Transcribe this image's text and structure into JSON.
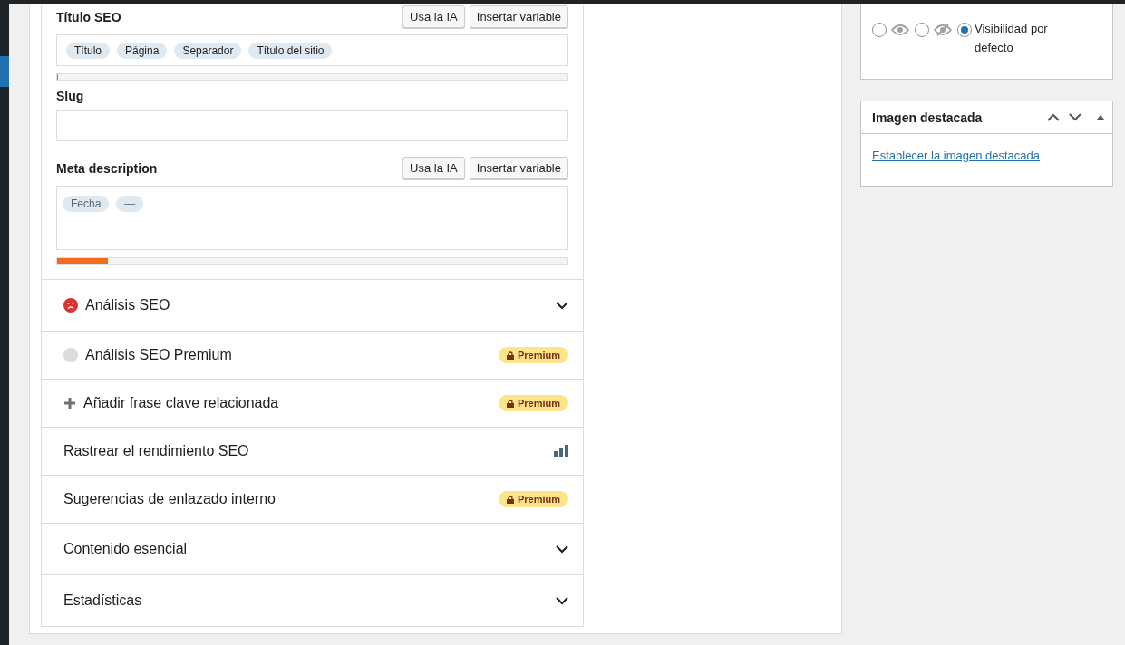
{
  "seo_title": {
    "label": "Título SEO",
    "buttons": [
      "Usa la IA",
      "Insertar variable"
    ],
    "tags": [
      "Título",
      "Página",
      "Separador",
      "Título del sitio"
    ],
    "level": 0
  },
  "slug": {
    "label": "Slug"
  },
  "meta_description": {
    "label": "Meta description",
    "buttons": [
      "Usa la IA",
      "Insertar variable"
    ],
    "tags": [
      "Fecha",
      "—"
    ],
    "level": 0.1
  },
  "sections": [
    {
      "label": "Análisis SEO",
      "kind": "analysis"
    },
    {
      "label": "Análisis SEO Premium",
      "kind": "premium-analysis",
      "badge": "Premium"
    },
    {
      "label": "Añadir frase clave relacionada",
      "kind": "premium-add",
      "badge": "Premium"
    },
    {
      "label": "Rastrear el rendimiento SEO",
      "kind": "performance"
    },
    {
      "label": "Sugerencias de enlazado interno",
      "kind": "premium",
      "badge": "Premium"
    },
    {
      "label": "Contenido esencial",
      "kind": "collapsible"
    },
    {
      "label": "Estadísticas",
      "kind": "collapsible"
    }
  ],
  "visibility": {
    "options": [
      {
        "kind": "eye",
        "selected": false
      },
      {
        "kind": "eye-off",
        "selected": false
      },
      {
        "kind": "label",
        "label": "Visibilidad por defecto",
        "selected": true
      }
    ]
  },
  "featured_image": {
    "title": "Imagen destacada",
    "link": "Establecer la imagen destacada"
  }
}
